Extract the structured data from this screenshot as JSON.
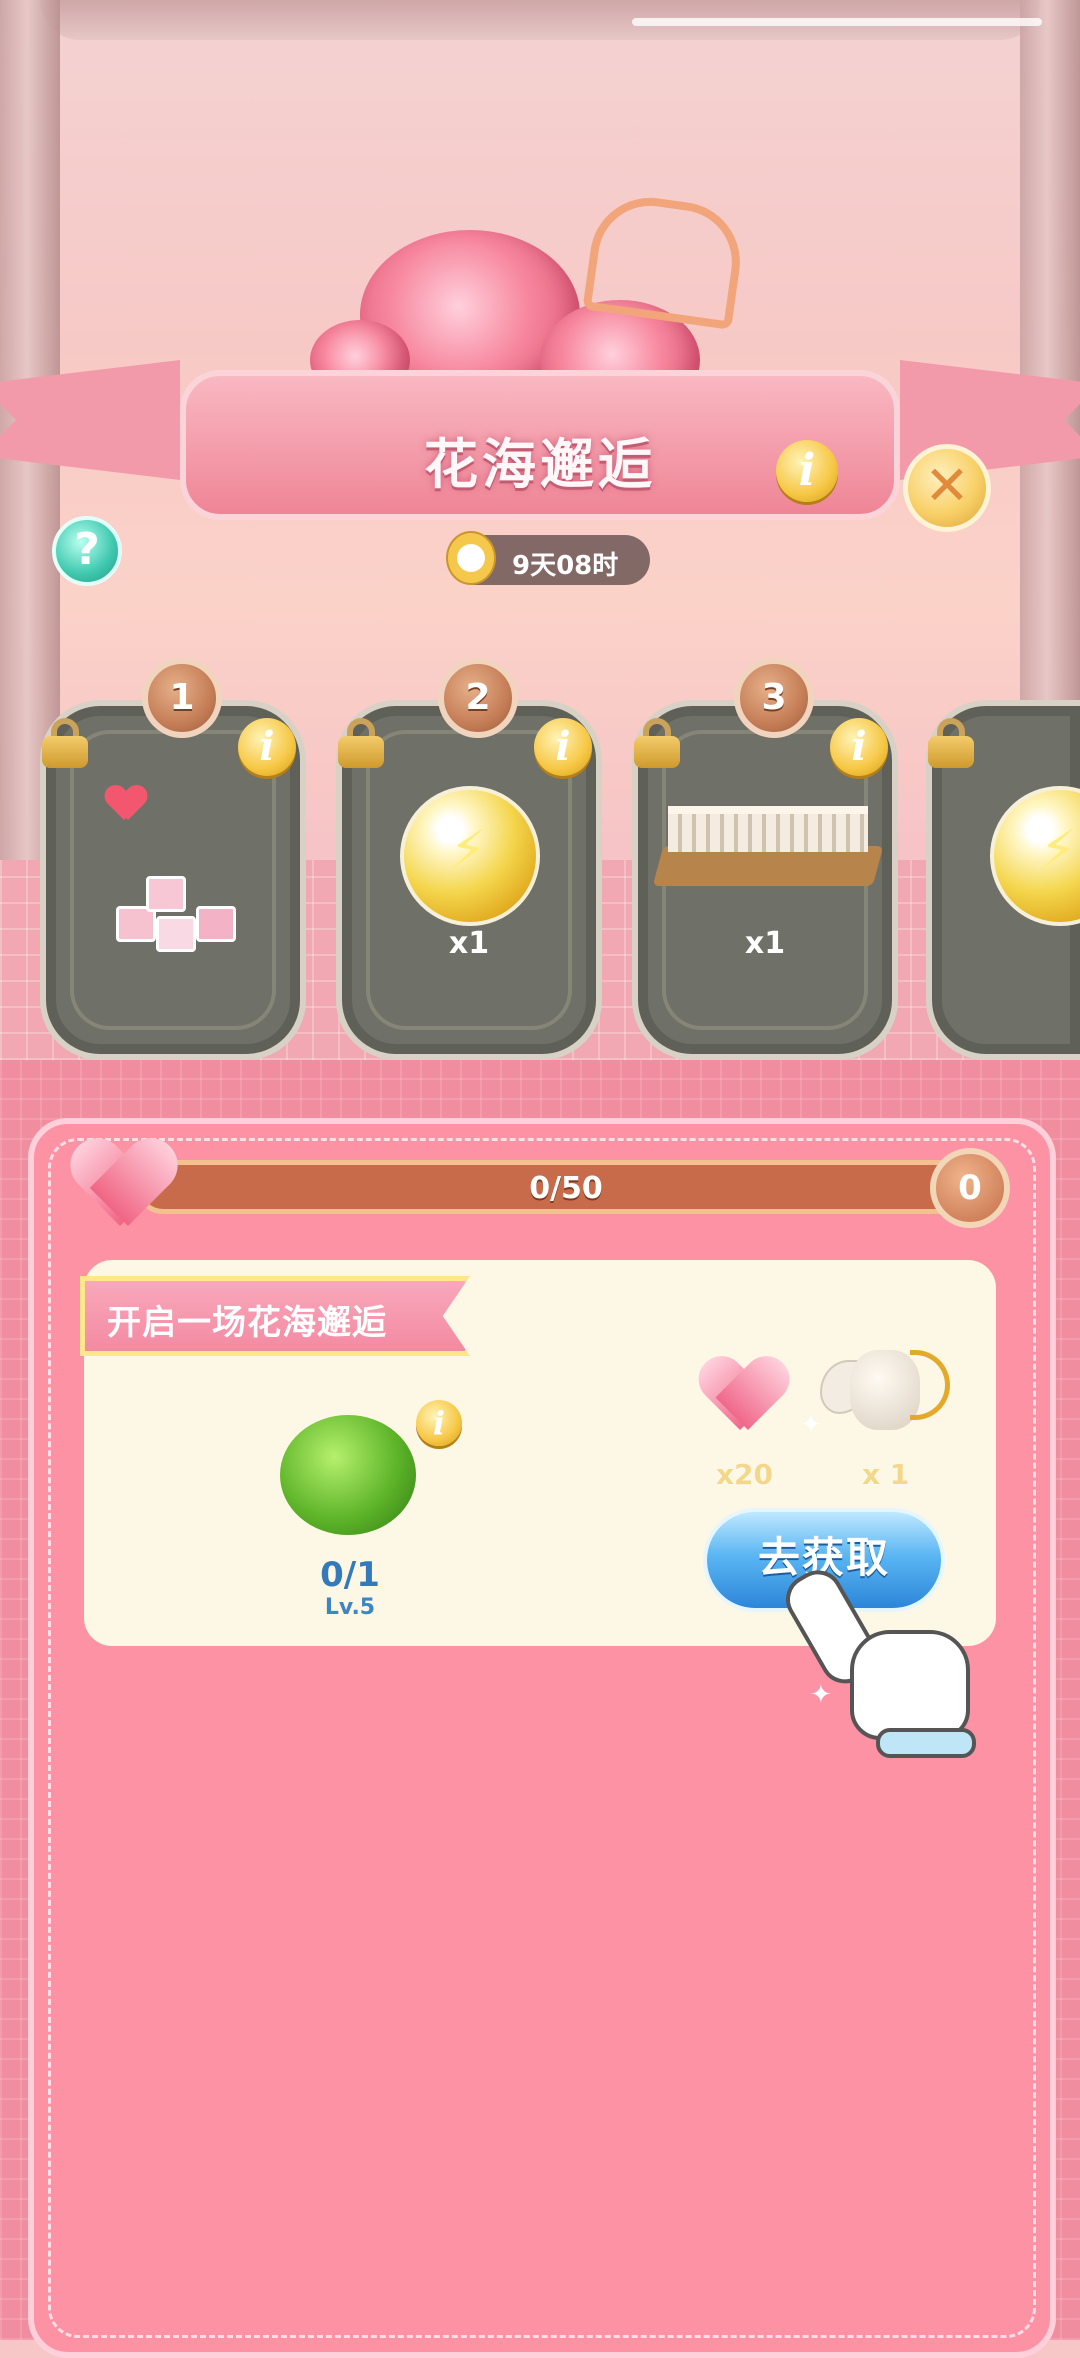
{
  "event": {
    "title": "花海邂逅",
    "timer": "9天08时",
    "help_symbol": "?",
    "info_symbol": "i",
    "close_symbol": "✕"
  },
  "stages": [
    {
      "number": "1",
      "reward": "heart-balloons-gift-pile",
      "quantity": "",
      "locked": true
    },
    {
      "number": "2",
      "reward": "energy-capsule",
      "quantity": "x1",
      "locked": true
    },
    {
      "number": "3",
      "reward": "balcony-terrace",
      "quantity": "x1",
      "locked": true
    }
  ],
  "progress": {
    "label": "0/50",
    "current": 0,
    "max": 50,
    "goal_badge": "0"
  },
  "task": {
    "title": "开启一场花海邂逅",
    "item_count": "0/1",
    "item_level": "Lv.5",
    "rewards": [
      {
        "icon": "heart-icon",
        "quantity": "x20"
      },
      {
        "icon": "cupid-statue-icon",
        "quantity": "x 1"
      }
    ],
    "button_label": "去获取"
  },
  "colors": {
    "panel": "#fe92a5",
    "card": "#6f7067",
    "button": "#2c86d9",
    "badge": "#f6c744"
  }
}
